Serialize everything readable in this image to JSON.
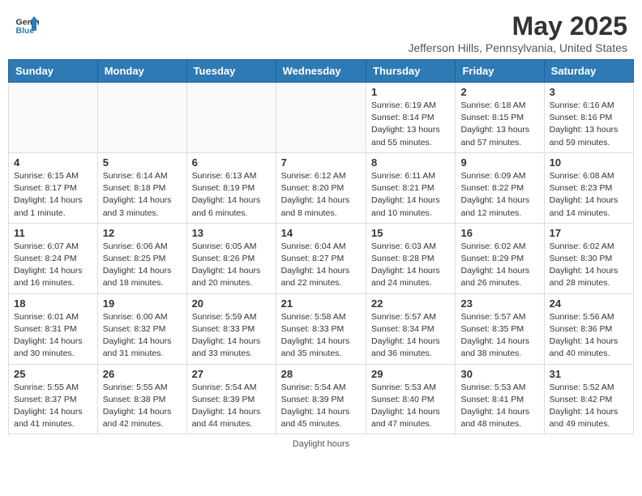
{
  "header": {
    "logo_line1": "General",
    "logo_line2": "Blue",
    "title": "May 2025",
    "subtitle": "Jefferson Hills, Pennsylvania, United States"
  },
  "days_of_week": [
    "Sunday",
    "Monday",
    "Tuesday",
    "Wednesday",
    "Thursday",
    "Friday",
    "Saturday"
  ],
  "weeks": [
    [
      {
        "day": "",
        "info": ""
      },
      {
        "day": "",
        "info": ""
      },
      {
        "day": "",
        "info": ""
      },
      {
        "day": "",
        "info": ""
      },
      {
        "day": "1",
        "info": "Sunrise: 6:19 AM\nSunset: 8:14 PM\nDaylight: 13 hours\nand 55 minutes."
      },
      {
        "day": "2",
        "info": "Sunrise: 6:18 AM\nSunset: 8:15 PM\nDaylight: 13 hours\nand 57 minutes."
      },
      {
        "day": "3",
        "info": "Sunrise: 6:16 AM\nSunset: 8:16 PM\nDaylight: 13 hours\nand 59 minutes."
      }
    ],
    [
      {
        "day": "4",
        "info": "Sunrise: 6:15 AM\nSunset: 8:17 PM\nDaylight: 14 hours\nand 1 minute."
      },
      {
        "day": "5",
        "info": "Sunrise: 6:14 AM\nSunset: 8:18 PM\nDaylight: 14 hours\nand 3 minutes."
      },
      {
        "day": "6",
        "info": "Sunrise: 6:13 AM\nSunset: 8:19 PM\nDaylight: 14 hours\nand 6 minutes."
      },
      {
        "day": "7",
        "info": "Sunrise: 6:12 AM\nSunset: 8:20 PM\nDaylight: 14 hours\nand 8 minutes."
      },
      {
        "day": "8",
        "info": "Sunrise: 6:11 AM\nSunset: 8:21 PM\nDaylight: 14 hours\nand 10 minutes."
      },
      {
        "day": "9",
        "info": "Sunrise: 6:09 AM\nSunset: 8:22 PM\nDaylight: 14 hours\nand 12 minutes."
      },
      {
        "day": "10",
        "info": "Sunrise: 6:08 AM\nSunset: 8:23 PM\nDaylight: 14 hours\nand 14 minutes."
      }
    ],
    [
      {
        "day": "11",
        "info": "Sunrise: 6:07 AM\nSunset: 8:24 PM\nDaylight: 14 hours\nand 16 minutes."
      },
      {
        "day": "12",
        "info": "Sunrise: 6:06 AM\nSunset: 8:25 PM\nDaylight: 14 hours\nand 18 minutes."
      },
      {
        "day": "13",
        "info": "Sunrise: 6:05 AM\nSunset: 8:26 PM\nDaylight: 14 hours\nand 20 minutes."
      },
      {
        "day": "14",
        "info": "Sunrise: 6:04 AM\nSunset: 8:27 PM\nDaylight: 14 hours\nand 22 minutes."
      },
      {
        "day": "15",
        "info": "Sunrise: 6:03 AM\nSunset: 8:28 PM\nDaylight: 14 hours\nand 24 minutes."
      },
      {
        "day": "16",
        "info": "Sunrise: 6:02 AM\nSunset: 8:29 PM\nDaylight: 14 hours\nand 26 minutes."
      },
      {
        "day": "17",
        "info": "Sunrise: 6:02 AM\nSunset: 8:30 PM\nDaylight: 14 hours\nand 28 minutes."
      }
    ],
    [
      {
        "day": "18",
        "info": "Sunrise: 6:01 AM\nSunset: 8:31 PM\nDaylight: 14 hours\nand 30 minutes."
      },
      {
        "day": "19",
        "info": "Sunrise: 6:00 AM\nSunset: 8:32 PM\nDaylight: 14 hours\nand 31 minutes."
      },
      {
        "day": "20",
        "info": "Sunrise: 5:59 AM\nSunset: 8:33 PM\nDaylight: 14 hours\nand 33 minutes."
      },
      {
        "day": "21",
        "info": "Sunrise: 5:58 AM\nSunset: 8:33 PM\nDaylight: 14 hours\nand 35 minutes."
      },
      {
        "day": "22",
        "info": "Sunrise: 5:57 AM\nSunset: 8:34 PM\nDaylight: 14 hours\nand 36 minutes."
      },
      {
        "day": "23",
        "info": "Sunrise: 5:57 AM\nSunset: 8:35 PM\nDaylight: 14 hours\nand 38 minutes."
      },
      {
        "day": "24",
        "info": "Sunrise: 5:56 AM\nSunset: 8:36 PM\nDaylight: 14 hours\nand 40 minutes."
      }
    ],
    [
      {
        "day": "25",
        "info": "Sunrise: 5:55 AM\nSunset: 8:37 PM\nDaylight: 14 hours\nand 41 minutes."
      },
      {
        "day": "26",
        "info": "Sunrise: 5:55 AM\nSunset: 8:38 PM\nDaylight: 14 hours\nand 42 minutes."
      },
      {
        "day": "27",
        "info": "Sunrise: 5:54 AM\nSunset: 8:39 PM\nDaylight: 14 hours\nand 44 minutes."
      },
      {
        "day": "28",
        "info": "Sunrise: 5:54 AM\nSunset: 8:39 PM\nDaylight: 14 hours\nand 45 minutes."
      },
      {
        "day": "29",
        "info": "Sunrise: 5:53 AM\nSunset: 8:40 PM\nDaylight: 14 hours\nand 47 minutes."
      },
      {
        "day": "30",
        "info": "Sunrise: 5:53 AM\nSunset: 8:41 PM\nDaylight: 14 hours\nand 48 minutes."
      },
      {
        "day": "31",
        "info": "Sunrise: 5:52 AM\nSunset: 8:42 PM\nDaylight: 14 hours\nand 49 minutes."
      }
    ]
  ],
  "footer": {
    "note": "Daylight hours"
  },
  "colors": {
    "header_bg": "#2e7ab5",
    "header_text": "#ffffff",
    "border": "#cccccc"
  }
}
